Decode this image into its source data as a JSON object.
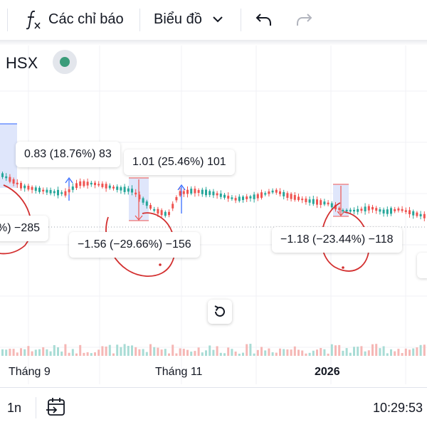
{
  "toolbar": {
    "indicators_icon": "function-fx-icon",
    "indicators_label": "Các chỉ báo",
    "chart_type_label": "Biểu đồ",
    "chart_type_icon": "chevron-down-icon",
    "undo_icon": "undo-icon",
    "redo_icon": "redo-icon"
  },
  "symbol": {
    "exchange": "HSX",
    "market_status_color": "#3b9c7a"
  },
  "measurements": [
    {
      "text": "%) −285"
    },
    {
      "text": "0.83 (18.76%) 83"
    },
    {
      "text": "1.01 (25.46%) 101"
    },
    {
      "text": "−1.56 (−29.66%) −156"
    },
    {
      "text": "−1.18 (−23.44%) −118"
    }
  ],
  "time_axis": {
    "labels": [
      "Tháng 9",
      "Tháng 11",
      "2026"
    ]
  },
  "bottom_bar": {
    "interval": "1n",
    "goto_date_icon": "calendar-arrow-icon",
    "clock": "10:29:53"
  },
  "colors": {
    "up": "#26a69a",
    "down": "#ef5350",
    "measure_fill": "#dfe6fb",
    "measure_line_up": "#2962ff",
    "annotation": "#d32f2f"
  },
  "reset_icon": "reset-rotate-icon"
}
